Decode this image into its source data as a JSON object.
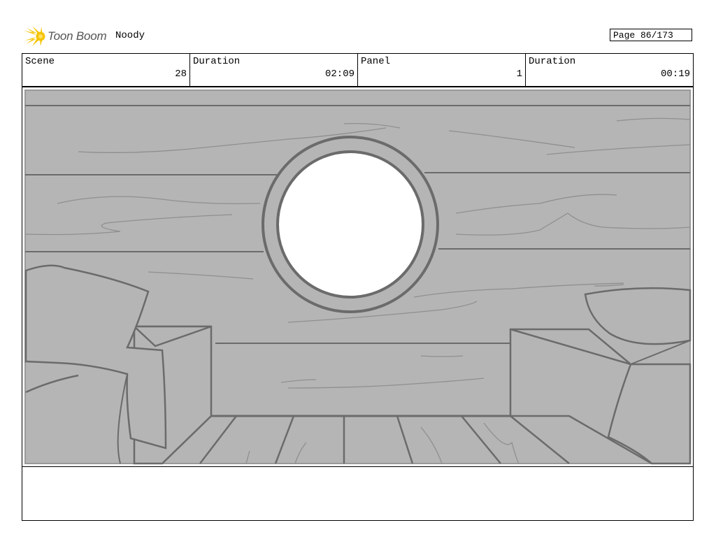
{
  "header": {
    "logo_text": "Toon Boom",
    "project_name": "Noody",
    "page_label": "Page 86/173"
  },
  "info": {
    "scene_label": "Scene",
    "scene_value": "28",
    "scene_duration_label": "Duration",
    "scene_duration_value": "02:09",
    "panel_label": "Panel",
    "panel_value": "1",
    "panel_duration_label": "Duration",
    "panel_duration_value": "00:19"
  },
  "notes": {
    "text": ""
  }
}
